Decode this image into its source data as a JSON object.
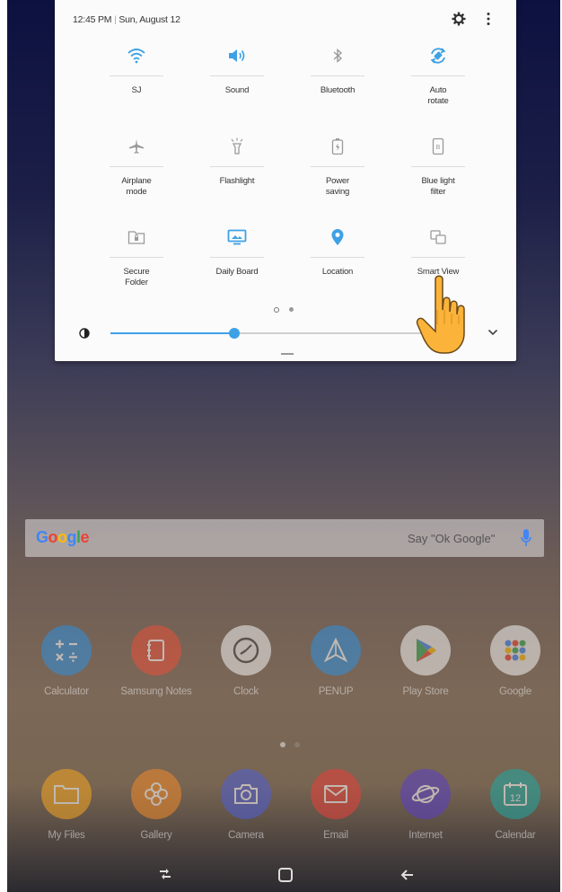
{
  "status": {
    "time": "12:45 PM",
    "date": "Sun, August 12"
  },
  "tiles": [
    {
      "label": "SJ",
      "icon": "wifi-icon",
      "active": true
    },
    {
      "label": "Sound",
      "icon": "sound-icon",
      "active": true
    },
    {
      "label": "Bluetooth",
      "icon": "bluetooth-icon",
      "active": false
    },
    {
      "label": "Auto\nrotate",
      "icon": "auto-rotate-icon",
      "active": true
    },
    {
      "label": "Airplane\nmode",
      "icon": "airplane-icon",
      "active": false
    },
    {
      "label": "Flashlight",
      "icon": "flashlight-icon",
      "active": false
    },
    {
      "label": "Power\nsaving",
      "icon": "power-saving-icon",
      "active": false
    },
    {
      "label": "Blue light\nfilter",
      "icon": "blue-light-icon",
      "active": false
    },
    {
      "label": "Secure\nFolder",
      "icon": "secure-folder-icon",
      "active": false
    },
    {
      "label": "Daily Board",
      "icon": "daily-board-icon",
      "active": true
    },
    {
      "label": "Location",
      "icon": "location-icon",
      "active": true
    },
    {
      "label": "Smart View",
      "icon": "smart-view-icon",
      "active": false
    }
  ],
  "panel_page": {
    "current": 1,
    "total": 2
  },
  "brightness": {
    "level": 0.38
  },
  "search": {
    "brand": "Google",
    "hint": "Say \"Ok Google\""
  },
  "apps_row1": [
    {
      "name": "Calculator",
      "icon": "calculator-icon",
      "color": "#2f8fdc"
    },
    {
      "name": "Samsung Notes",
      "icon": "notes-icon",
      "color": "#e8503a"
    },
    {
      "name": "Clock",
      "icon": "clock-icon",
      "color": "#f2f2f2"
    },
    {
      "name": "PENUP",
      "icon": "penup-icon",
      "color": "#2f8fdc"
    },
    {
      "name": "Play Store",
      "icon": "play-store-icon",
      "color": "#f2f2f2"
    },
    {
      "name": "Google",
      "icon": "google-folder-icon",
      "color": "#f2f2f2"
    }
  ],
  "apps_row2": [
    {
      "name": "My Files",
      "icon": "folder-icon",
      "color": "#f5a623"
    },
    {
      "name": "Gallery",
      "icon": "gallery-icon",
      "color": "#f08a2a"
    },
    {
      "name": "Camera",
      "icon": "camera-icon",
      "color": "#4f5fd6"
    },
    {
      "name": "Email",
      "icon": "email-icon",
      "color": "#e8403a"
    },
    {
      "name": "Internet",
      "icon": "internet-icon",
      "color": "#5a3fc8"
    },
    {
      "name": "Calendar",
      "icon": "calendar-icon",
      "color": "#1fa8a2",
      "day": "12"
    }
  ],
  "home_page": {
    "current": 1,
    "total": 2
  },
  "colors": {
    "active": "#3ea1e6",
    "inactive": "#9a9a9a"
  }
}
